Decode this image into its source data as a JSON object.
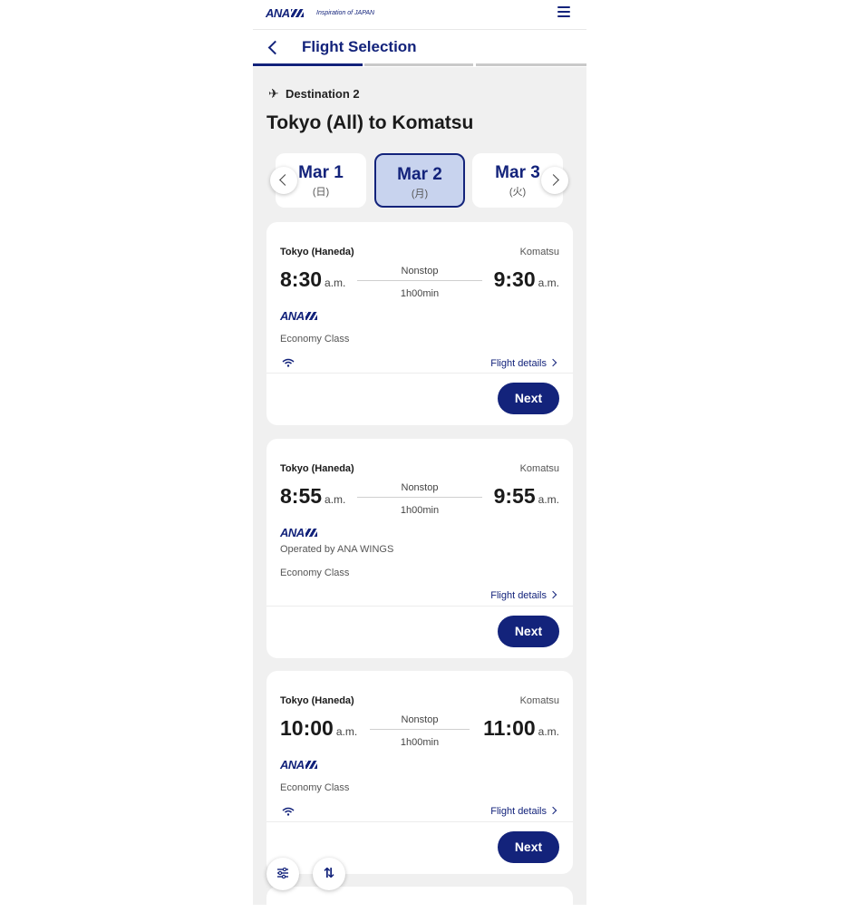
{
  "header": {
    "logo": "ANA",
    "tagline": "Inspiration of JAPAN",
    "menu_icon": "hamburger-menu-icon"
  },
  "nav": {
    "back_icon": "chevron-left-icon",
    "title": "Flight Selection",
    "progress_steps": 3,
    "progress_current": 1
  },
  "destination": {
    "label": "Destination 2",
    "icon": "airplane-icon",
    "route": "Tokyo (All) to Komatsu"
  },
  "dates": [
    {
      "date": "Mar 1",
      "weekday": "(日)",
      "selected": false
    },
    {
      "date": "Mar 2",
      "weekday": "(月)",
      "selected": true
    },
    {
      "date": "Mar 3",
      "weekday": "(火)",
      "selected": false
    }
  ],
  "flights": [
    {
      "origin": "Tokyo (Haneda)",
      "destination": "Komatsu",
      "dep_time": "8:30",
      "dep_ampm": "a.m.",
      "arr_time": "9:30",
      "arr_ampm": "a.m.",
      "stops": "Nonstop",
      "duration": "1h00min",
      "airline": "ANA",
      "operated_by": "",
      "class": "Economy Class",
      "wifi": true,
      "details_label": "Flight details",
      "next_label": "Next"
    },
    {
      "origin": "Tokyo (Haneda)",
      "destination": "Komatsu",
      "dep_time": "8:55",
      "dep_ampm": "a.m.",
      "arr_time": "9:55",
      "arr_ampm": "a.m.",
      "stops": "Nonstop",
      "duration": "1h00min",
      "airline": "ANA",
      "operated_by": "Operated by ANA WINGS",
      "class": "Economy Class",
      "wifi": false,
      "details_label": "Flight details",
      "next_label": "Next"
    },
    {
      "origin": "Tokyo (Haneda)",
      "destination": "Komatsu",
      "dep_time": "10:00",
      "dep_ampm": "a.m.",
      "arr_time": "11:00",
      "arr_ampm": "a.m.",
      "stops": "Nonstop",
      "duration": "1h00min",
      "airline": "ANA",
      "operated_by": "",
      "class": "Economy Class",
      "wifi": true,
      "details_label": "Flight details",
      "next_label": "Next"
    }
  ],
  "fabs": {
    "filter_icon": "filter-sliders-icon",
    "sort_icon": "sort-arrows-icon"
  },
  "colors": {
    "brand": "#13237b",
    "selected_date_bg": "#c8d3ee",
    "page_bg": "#f0f0f0"
  }
}
